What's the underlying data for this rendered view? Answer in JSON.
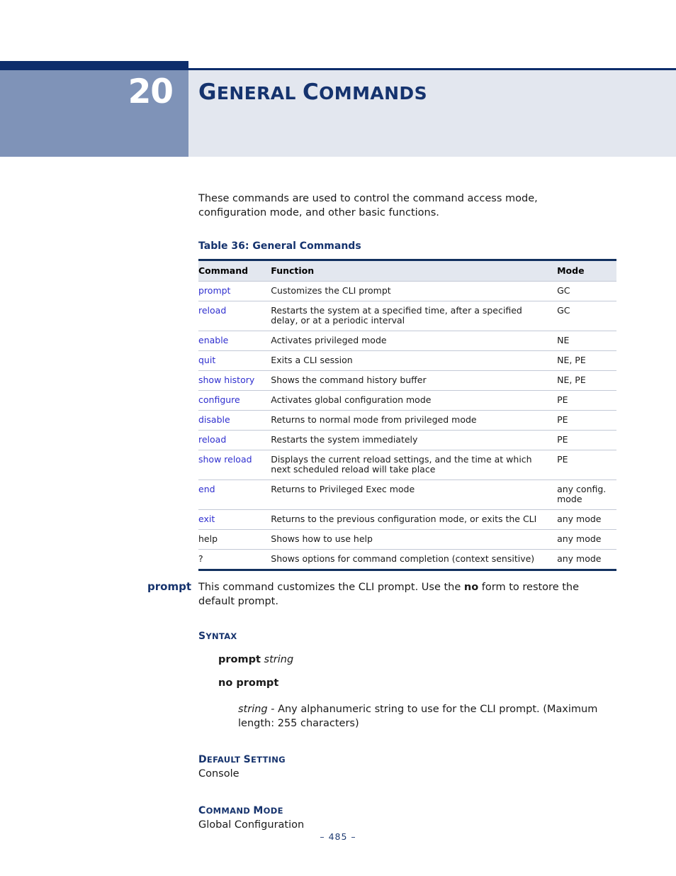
{
  "chapter": {
    "number": "20",
    "title_words": [
      {
        "first": "G",
        "rest": "ENERAL"
      },
      {
        "first": "C",
        "rest": "OMMANDS"
      }
    ],
    "title_plain": "General Commands"
  },
  "intro": {
    "paragraph": "These commands are used to control the command access mode, configuration mode, and other basic functions."
  },
  "table": {
    "caption": "Table 36: General Commands",
    "headers": [
      "Command",
      "Function",
      "Mode"
    ],
    "rows": [
      {
        "command": "prompt",
        "link": true,
        "function": "Customizes the CLI prompt",
        "mode": "GC"
      },
      {
        "command": "reload",
        "link": true,
        "function": "Restarts the system at a specified time, after a specified delay, or at a periodic interval",
        "mode": "GC"
      },
      {
        "command": "enable",
        "link": true,
        "function": "Activates privileged mode",
        "mode": "NE"
      },
      {
        "command": "quit",
        "link": true,
        "function": "Exits a CLI session",
        "mode": "NE, PE"
      },
      {
        "command": "show history",
        "link": true,
        "function": "Shows the command history buffer",
        "mode": "NE, PE"
      },
      {
        "command": "configure",
        "link": true,
        "function": "Activates global configuration mode",
        "mode": "PE"
      },
      {
        "command": "disable",
        "link": true,
        "function": "Returns to normal mode from privileged mode",
        "mode": "PE"
      },
      {
        "command": "reload",
        "link": true,
        "function": "Restarts the system immediately",
        "mode": "PE"
      },
      {
        "command": "show reload",
        "link": true,
        "function": "Displays the current reload settings, and the time at which next scheduled reload will take place",
        "mode": "PE"
      },
      {
        "command": "end",
        "link": true,
        "function": "Returns to Privileged Exec mode",
        "mode": "any config. mode"
      },
      {
        "command": "exit",
        "link": true,
        "function": "Returns to the previous configuration mode, or exits the CLI",
        "mode": "any mode"
      },
      {
        "command": "help",
        "link": false,
        "function": "Shows how to use help",
        "mode": "any mode"
      },
      {
        "command": "?",
        "link": false,
        "function": "Shows options for command completion (context sensitive)",
        "mode": "any mode"
      }
    ]
  },
  "prompt_section": {
    "command_name": "prompt",
    "description_before": "This command customizes the CLI prompt. Use the ",
    "description_bold": "no",
    "description_after": " form to restore the default prompt.",
    "syntax_heading": {
      "big": "S",
      "small": "YNTAX"
    },
    "syntax_line_1_bold": "prompt",
    "syntax_line_1_italic": "string",
    "syntax_line_2_bold": "no prompt",
    "param_italic": "string",
    "param_text": " - Any alphanumeric string to use for the CLI prompt. (Maximum length: 255 characters)",
    "default_setting_heading": {
      "big1": "D",
      "small1": "EFAULT ",
      "big2": "S",
      "small2": "ETTING"
    },
    "default_setting_value": "Console",
    "command_mode_heading": {
      "big1": "C",
      "small1": "OMMAND ",
      "big2": "M",
      "small2": "ODE"
    },
    "command_mode_value": "Global Configuration"
  },
  "footer": {
    "page_label": "–  485  –"
  },
  "colors": {
    "navy": "#0d2d6b",
    "header_gray": "#7f93b8",
    "header_light": "#e3e7ef",
    "link_blue": "#2f2fcf",
    "heading_navy": "#16336d"
  }
}
